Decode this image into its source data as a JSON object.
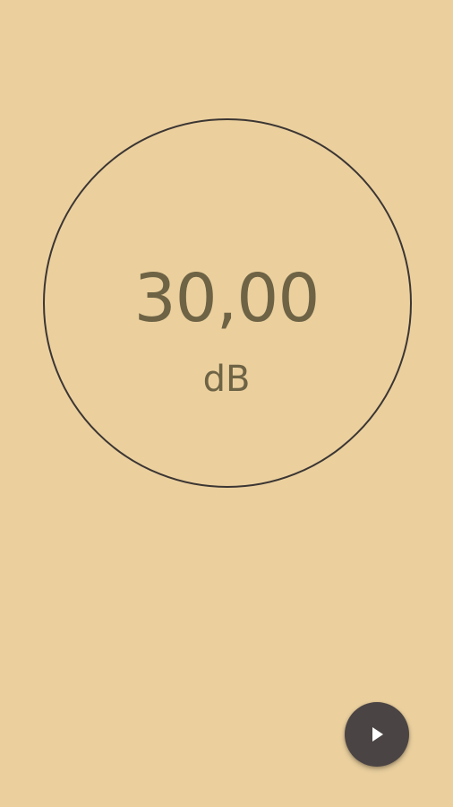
{
  "colors": {
    "background": "#ebd09e",
    "ring": "#3c3633",
    "text": "#6e6345",
    "fab_background": "#4a4444",
    "fab_icon": "#ffffff"
  },
  "meter": {
    "value": "30,00",
    "unit": "dB"
  },
  "fab": {
    "icon": "play-icon"
  }
}
